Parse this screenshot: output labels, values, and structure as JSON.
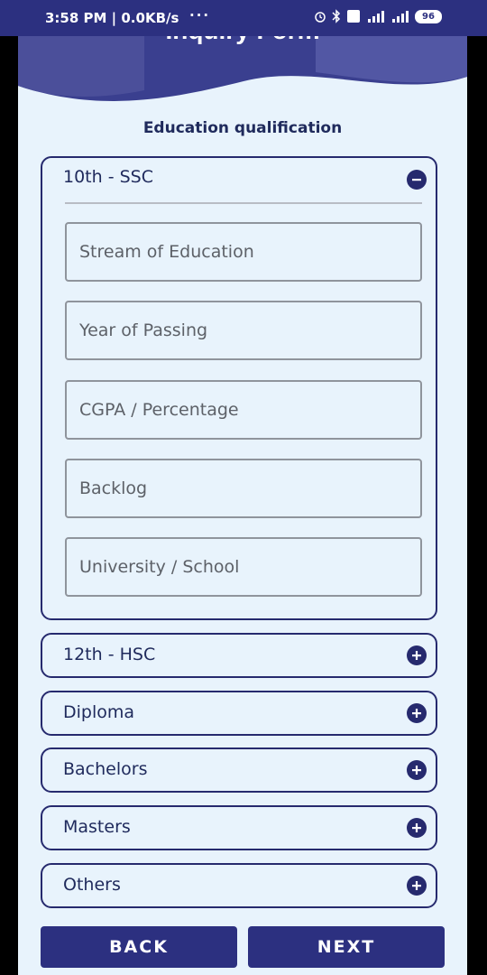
{
  "status_bar": {
    "time_info": "3:58 PM | 0.0KB/s",
    "dots": "···",
    "battery": "96"
  },
  "banner": {
    "title": "Inquiry Form"
  },
  "section_title": "Education qualification",
  "accordions": [
    {
      "label": "10th - SSC",
      "expanded": true,
      "fields": [
        {
          "placeholder": "Stream of Education"
        },
        {
          "placeholder": "Year of Passing"
        },
        {
          "placeholder": "CGPA / Percentage"
        },
        {
          "placeholder": "Backlog"
        },
        {
          "placeholder": "University / School"
        }
      ]
    },
    {
      "label": "12th - HSC",
      "expanded": false
    },
    {
      "label": "Diploma",
      "expanded": false
    },
    {
      "label": "Bachelors",
      "expanded": false
    },
    {
      "label": "Masters",
      "expanded": false
    },
    {
      "label": "Others",
      "expanded": false
    }
  ],
  "buttons": {
    "back": "BACK",
    "next": "NEXT"
  },
  "colors": {
    "primary": "#2c3080",
    "background": "#e8f3fc",
    "text_dark": "#1f2a5c"
  }
}
